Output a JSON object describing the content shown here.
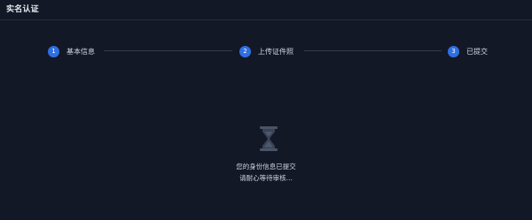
{
  "header": {
    "title": "实名认证"
  },
  "steps": [
    {
      "number": "1",
      "label": "基本信息"
    },
    {
      "number": "2",
      "label": "上传证件照"
    },
    {
      "number": "3",
      "label": "已提交"
    }
  ],
  "status": {
    "icon": "hourglass-icon",
    "line1": "您的身份信息已提交",
    "line2": "请耐心等待审核..."
  },
  "colors": {
    "background": "#131826",
    "accent": "#2f6fe4"
  }
}
